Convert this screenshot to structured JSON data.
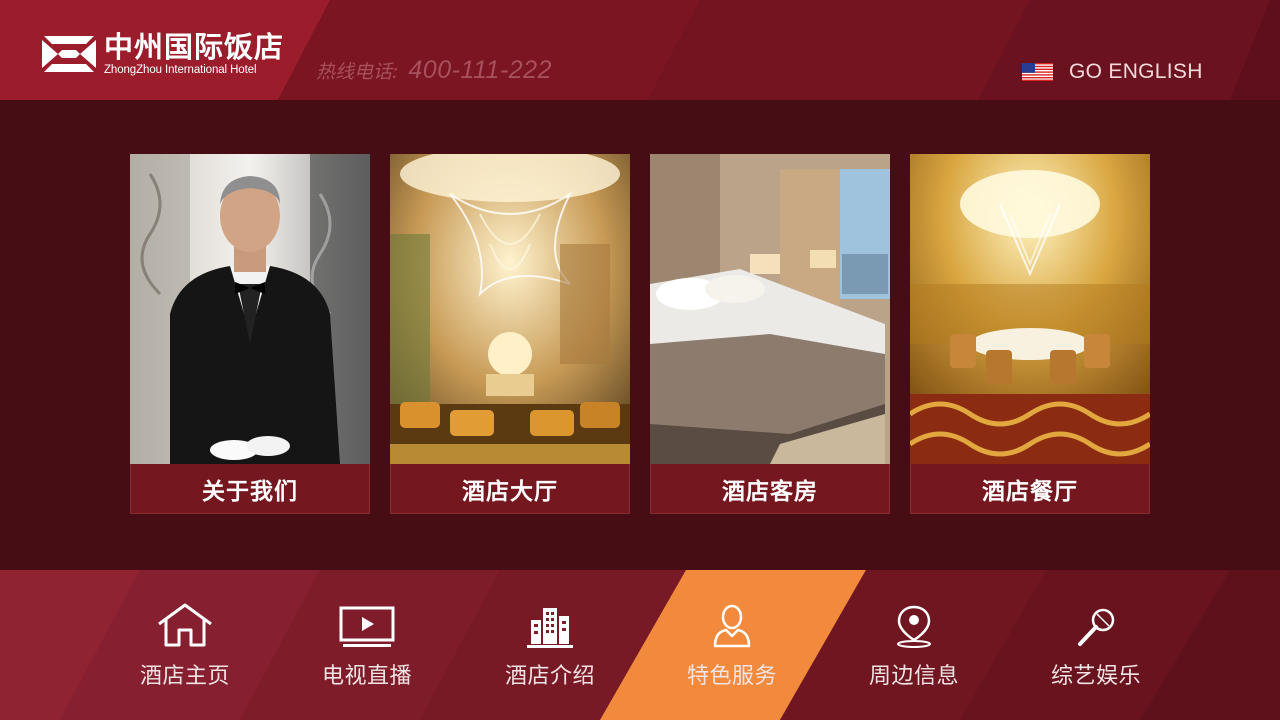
{
  "header": {
    "logo_cn": "中州国际饭店",
    "logo_en": "ZhongZhou International Hotel",
    "hotline_label": "热线电话:",
    "hotline_number": "400-111-222",
    "language_button": "GO ENGLISH"
  },
  "cards": [
    {
      "label": "关于我们"
    },
    {
      "label": "酒店大厅"
    },
    {
      "label": "酒店客房"
    },
    {
      "label": "酒店餐厅"
    }
  ],
  "nav": {
    "items": [
      {
        "label": "酒店主页",
        "icon": "home-icon",
        "active": false
      },
      {
        "label": "电视直播",
        "icon": "tv-play-icon",
        "active": false
      },
      {
        "label": "酒店介绍",
        "icon": "building-icon",
        "active": false
      },
      {
        "label": "特色服务",
        "icon": "user-icon",
        "active": true
      },
      {
        "label": "周边信息",
        "icon": "location-pin-icon",
        "active": false
      },
      {
        "label": "综艺娱乐",
        "icon": "microphone-icon",
        "active": false
      }
    ]
  },
  "colors": {
    "background": "#470d15",
    "header": "#701420",
    "nav": "#7d1a26",
    "active_tab": "#f28a3d",
    "hotline_text": "#a8505c"
  }
}
